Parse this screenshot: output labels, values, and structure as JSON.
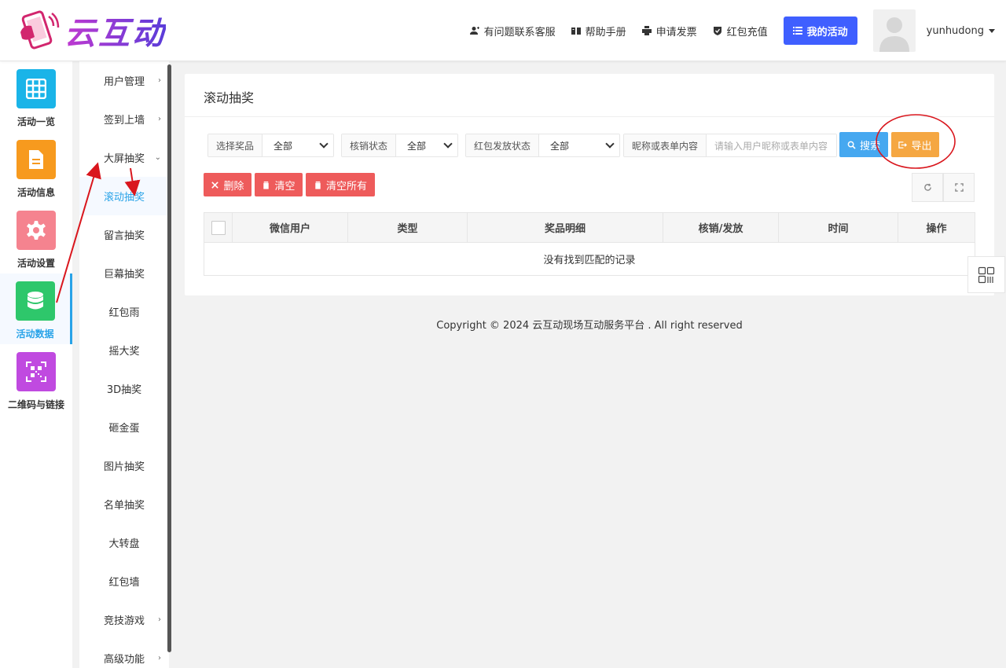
{
  "header": {
    "logo_text": "云互动",
    "links": [
      {
        "label": "有问题联系客服",
        "icon": "user-plus-icon"
      },
      {
        "label": "帮助手册",
        "icon": "book-icon"
      },
      {
        "label": "申请发票",
        "icon": "printer-icon"
      },
      {
        "label": "红包充值",
        "icon": "shield-check-icon"
      }
    ],
    "my_activity_label": "我的活动",
    "username": "yunhudong"
  },
  "icon_sidebar": [
    {
      "label": "活动一览",
      "color": "#1ab4e8",
      "icon": "grid-icon"
    },
    {
      "label": "活动信息",
      "color": "#f79a1e",
      "icon": "document-icon"
    },
    {
      "label": "活动设置",
      "color": "#f5838f",
      "icon": "gear-icon"
    },
    {
      "label": "活动数据",
      "color": "#2ec76b",
      "icon": "database-icon",
      "active": true
    },
    {
      "label": "二维码与链接",
      "color": "#c04ae0",
      "icon": "qrcode-icon"
    }
  ],
  "sub_menu": [
    {
      "label": "用户管理",
      "chevron": "›"
    },
    {
      "label": "签到上墙",
      "chevron": "›"
    },
    {
      "label": "大屏抽奖",
      "chevron": "⌄"
    },
    {
      "label": "滚动抽奖",
      "active": true
    },
    {
      "label": "留言抽奖"
    },
    {
      "label": "巨幕抽奖"
    },
    {
      "label": "红包雨"
    },
    {
      "label": "摇大奖"
    },
    {
      "label": "3D抽奖"
    },
    {
      "label": "砸金蛋"
    },
    {
      "label": "图片抽奖"
    },
    {
      "label": "名单抽奖"
    },
    {
      "label": "大转盘"
    },
    {
      "label": "红包墙"
    },
    {
      "label": "竞技游戏",
      "chevron": "›"
    },
    {
      "label": "高级功能",
      "chevron": "›"
    }
  ],
  "main": {
    "title": "滚动抽奖",
    "filters": {
      "prize_label": "选择奖品",
      "prize_value": "全部",
      "verify_label": "核销状态",
      "verify_value": "全部",
      "redpack_label": "红包发放状态",
      "redpack_value": "全部",
      "keyword_label": "昵称或表单内容",
      "keyword_placeholder": "请输入用户昵称或表单内容"
    },
    "buttons": {
      "search": "搜索",
      "export": "导出",
      "delete": "删除",
      "clear": "清空",
      "clear_all": "清空所有"
    },
    "table": {
      "columns": [
        "微信用户",
        "类型",
        "奖品明细",
        "核销/发放",
        "时间",
        "操作"
      ],
      "empty_text": "没有找到匹配的记录"
    }
  },
  "footer": "Copyright © 2024 云互动现场互动服务平台 . All right reserved",
  "colors": {
    "primary": "#3f5fff",
    "active_blue": "#29a3e8",
    "search": "#46a8f0",
    "export": "#f5a742",
    "danger": "#ee5b5b",
    "annotation_red": "#d9161d"
  }
}
